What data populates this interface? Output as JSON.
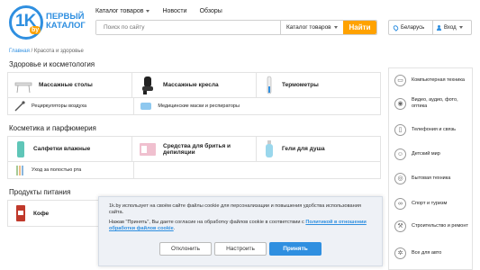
{
  "logo": {
    "one_k": "1K",
    "by": "by",
    "line1": "ПЕРВЫЙ",
    "line2": "КАТАЛОГ"
  },
  "topnav": {
    "catalog": "Каталог товаров",
    "news": "Новости",
    "reviews": "Обзоры"
  },
  "search": {
    "placeholder": "Поиск по сайту",
    "category": "Каталог товаров",
    "button": "Найти"
  },
  "region": "Беларусь",
  "login": "Вход",
  "breadcrumb": {
    "home": "Главная",
    "sep": "/",
    "current": "Красота и здоровье"
  },
  "sections": [
    {
      "title": "Здоровье и косметология",
      "row1": [
        "Массажные столы",
        "Массажные кресла",
        "Термометры"
      ],
      "row2": [
        "Рециркуляторы воздуха",
        "Медицинские маски и респираторы"
      ]
    },
    {
      "title": "Косметика и парфюмерия",
      "row1": [
        "Салфетки влажные",
        "Средства для бритья и депиляции",
        "Гели для душа"
      ],
      "row2": [
        "Уход за полостью рта"
      ]
    },
    {
      "title": "Продукты питания",
      "row1": [
        "Кофе"
      ]
    }
  ],
  "sidebar": [
    "Компьютерная техника",
    "Видео, аудио, фото, оптика",
    "Телефония и связь",
    "Детский мир",
    "Бытовая техника",
    "Спорт и туризм",
    "Строительство и ремонт",
    "Все для авто"
  ],
  "cookie": {
    "text1": "1k.by использует на своём сайте файлы cookie для персонализации и повышения удобства использования сайта.",
    "text2": "Нажав \"Принять\", Вы даете согласие на обработку файлов cookie в соответствии с",
    "link": "Политикой в отношении обработки файлов cookie",
    "text2_end": ".",
    "decline": "Отклонить",
    "configure": "Настроить",
    "accept": "Принять"
  },
  "colors": {
    "brand_blue": "#2f8fe0",
    "accent_orange": "#ffa200"
  }
}
